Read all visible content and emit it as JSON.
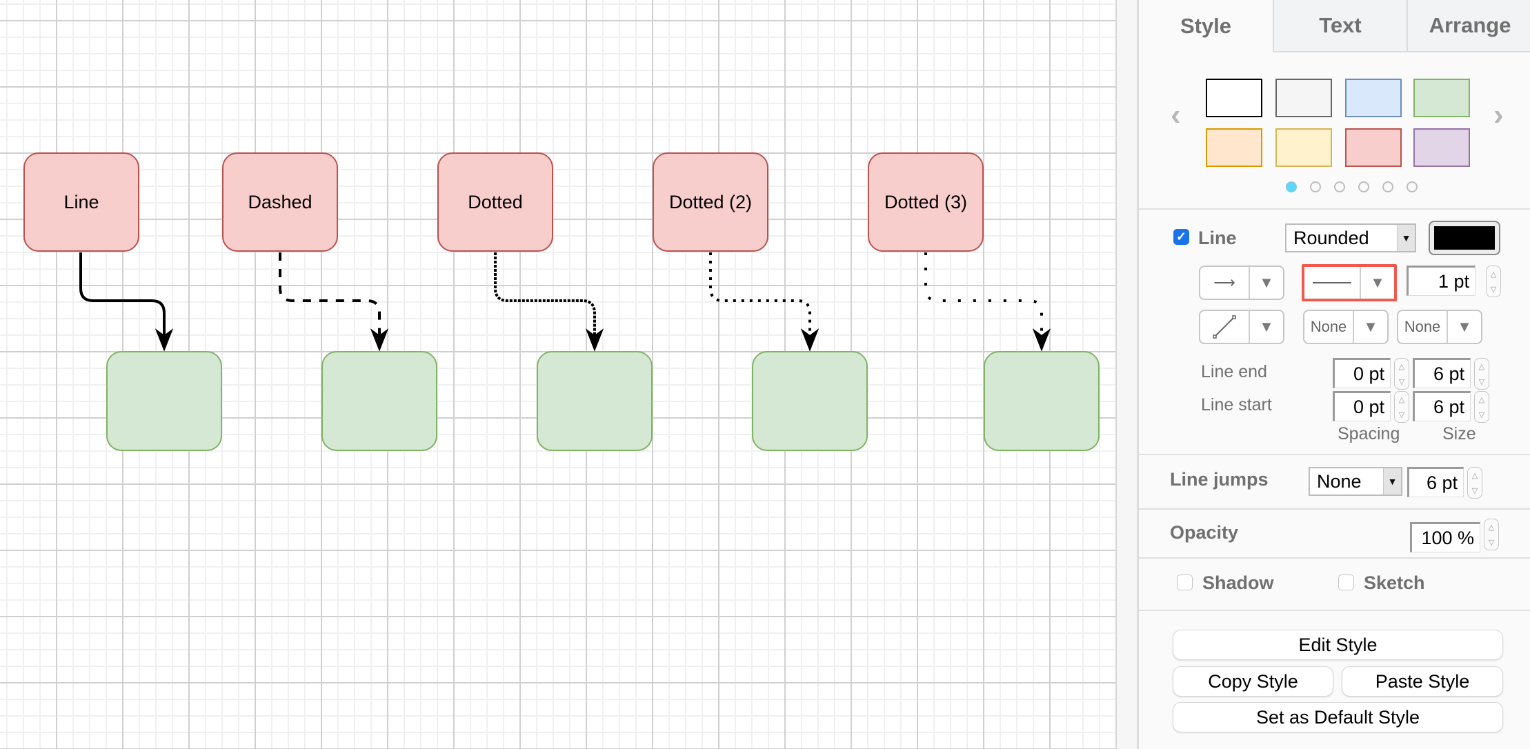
{
  "canvas": {
    "source_shapes": [
      {
        "label": "Line",
        "style": "solid"
      },
      {
        "label": "Dashed",
        "style": "dashed"
      },
      {
        "label": "Dotted",
        "style": "dotted"
      },
      {
        "label": "Dotted (2)",
        "style": "dotted-2"
      },
      {
        "label": "Dotted (3)",
        "style": "dotted-3"
      }
    ],
    "target_shapes_count": 5,
    "colors": {
      "source_fill": "#f8cecc",
      "source_stroke": "#b85450",
      "target_fill": "#d5e8d4",
      "target_stroke": "#82b366",
      "edge": "#000000"
    }
  },
  "panel": {
    "tabs": [
      {
        "label": "Style",
        "active": true
      },
      {
        "label": "Text",
        "active": false
      },
      {
        "label": "Arrange",
        "active": false
      }
    ],
    "swatches": [
      {
        "fill": "#ffffff",
        "stroke": "#000000"
      },
      {
        "fill": "#f5f5f5",
        "stroke": "#666666"
      },
      {
        "fill": "#dae8fc",
        "stroke": "#6c8ebf"
      },
      {
        "fill": "#d5e8d4",
        "stroke": "#82b366"
      },
      {
        "fill": "#ffe6cc",
        "stroke": "#d79b00"
      },
      {
        "fill": "#fff2cc",
        "stroke": "#d6b656"
      },
      {
        "fill": "#f8cecc",
        "stroke": "#b85450"
      },
      {
        "fill": "#e1d5e7",
        "stroke": "#9673a6"
      }
    ],
    "swatch_pages": 6,
    "swatch_page_active": 1,
    "line": {
      "label": "Line",
      "checked": true,
      "routing": "Rounded",
      "color": "#000000",
      "width": "1 pt",
      "line_start_marker": "None",
      "line_end_marker": "None",
      "line_end_label": "Line end",
      "line_start_label": "Line start",
      "line_end_spacing": "0 pt",
      "line_end_size": "6 pt",
      "line_start_spacing": "0 pt",
      "line_start_size": "6 pt",
      "spacing_label": "Spacing",
      "size_label": "Size"
    },
    "line_jumps": {
      "label": "Line jumps",
      "value": "None",
      "size": "6 pt"
    },
    "opacity": {
      "label": "Opacity",
      "value": "100 %"
    },
    "shadow": {
      "label": "Shadow",
      "checked": false
    },
    "sketch": {
      "label": "Sketch",
      "checked": false
    },
    "buttons": {
      "edit_style": "Edit Style",
      "copy_style": "Copy Style",
      "paste_style": "Paste Style",
      "set_default": "Set as Default Style"
    },
    "highlight_color": "#f05a4e"
  }
}
